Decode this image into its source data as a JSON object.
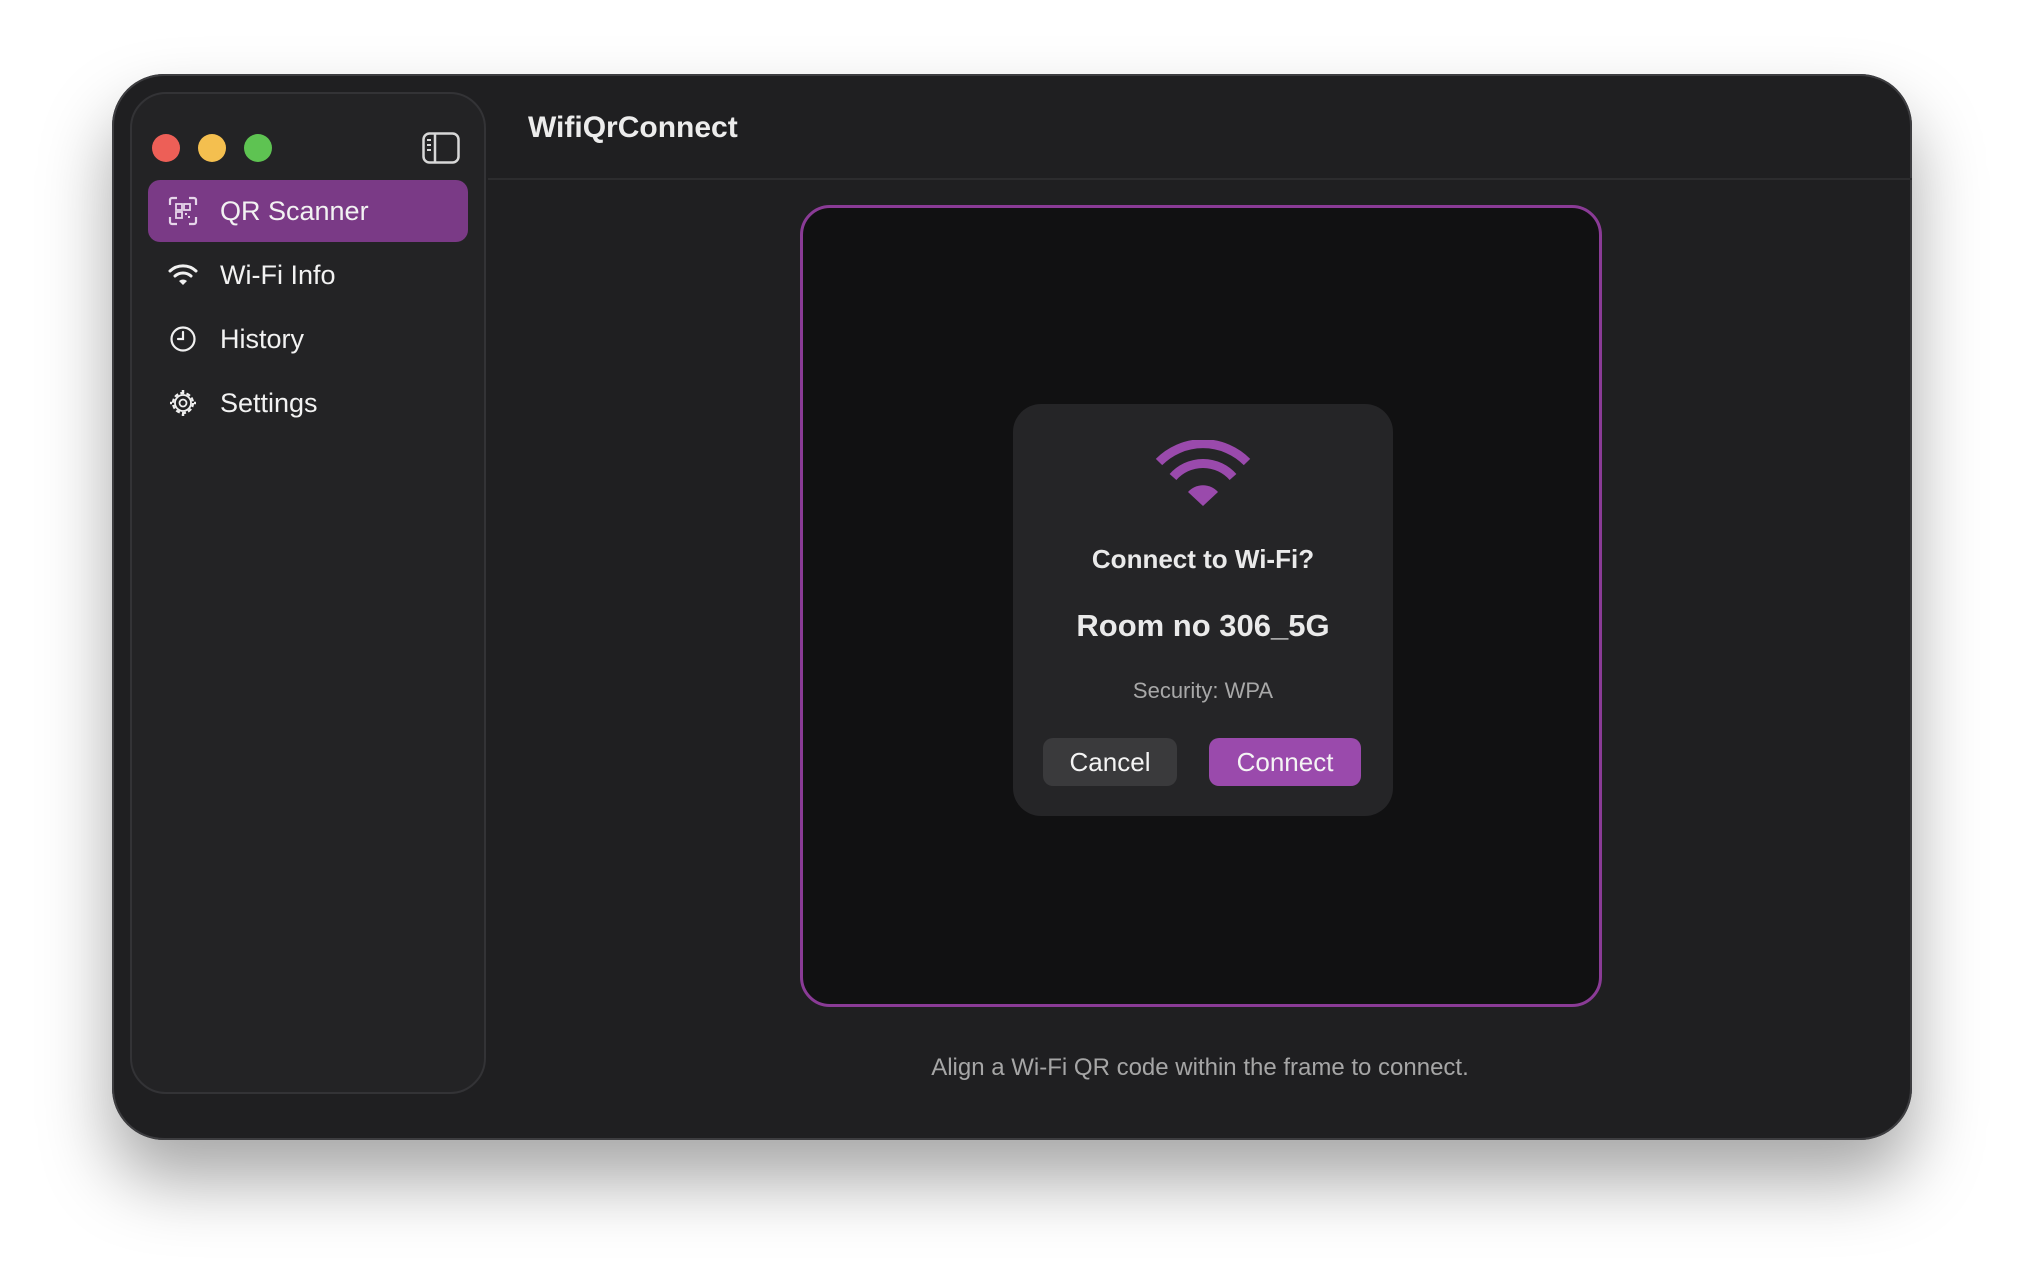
{
  "app": {
    "title": "WifiQrConnect"
  },
  "sidebar": {
    "items": [
      {
        "label": "QR Scanner",
        "icon": "qr-scan-icon",
        "selected": true
      },
      {
        "label": "Wi-Fi Info",
        "icon": "wifi-icon",
        "selected": false
      },
      {
        "label": "History",
        "icon": "clock-icon",
        "selected": false
      },
      {
        "label": "Settings",
        "icon": "gear-icon",
        "selected": false
      }
    ]
  },
  "dialog": {
    "icon": "wifi-icon",
    "title": "Connect to Wi-Fi?",
    "ssid": "Room no 306_5G",
    "security": "Security: WPA",
    "cancel_label": "Cancel",
    "connect_label": "Connect"
  },
  "hint": "Align a Wi-Fi QR code within the frame to connect.",
  "colors": {
    "accent": "#9a4aac",
    "selection": "#7a3a86",
    "window_bg": "#1f1f21",
    "frame_border": "#8a3b96"
  }
}
